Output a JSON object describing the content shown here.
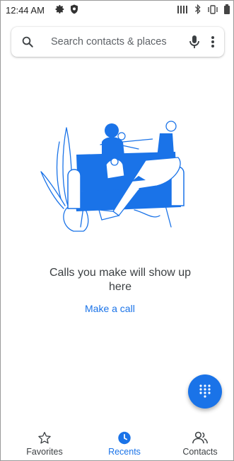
{
  "status_bar": {
    "time": "12:44 AM",
    "left_icons": [
      "gear-icon",
      "shield-icon"
    ],
    "right_icons": [
      "nfc-icon",
      "bluetooth-icon",
      "vibrate-icon",
      "battery-icon"
    ]
  },
  "search": {
    "placeholder": "Search contacts & places"
  },
  "empty_state": {
    "message": "Calls you make will show up here",
    "action": "Make a call"
  },
  "nav": {
    "items": [
      {
        "label": "Favorites",
        "icon": "star-icon",
        "active": false
      },
      {
        "label": "Recents",
        "icon": "clock-icon",
        "active": true
      },
      {
        "label": "Contacts",
        "icon": "people-icon",
        "active": false
      }
    ]
  },
  "colors": {
    "accent": "#1a73e8",
    "text_primary": "#3c4043",
    "text_secondary": "#5f6368"
  }
}
